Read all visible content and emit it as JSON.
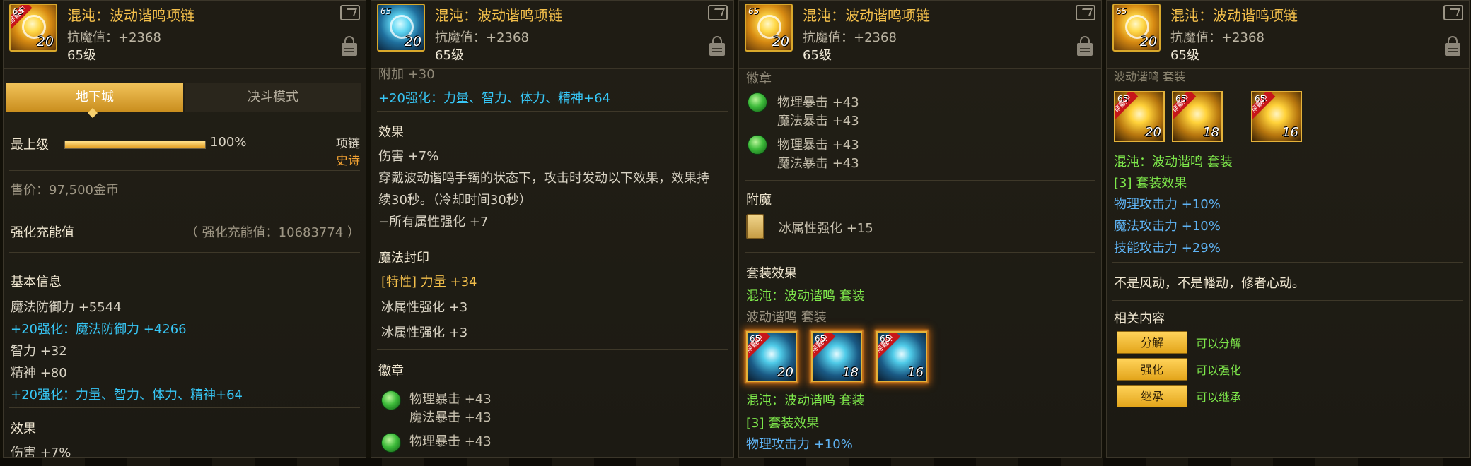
{
  "header": {
    "title": "混沌：波动谐鸣项链",
    "stat": "抗魔值：+2368",
    "level": "65级",
    "icon_level": "65",
    "icon_number": "20",
    "worn_ribbon": "穿戴中"
  },
  "panel1": {
    "tabs": [
      "地下城",
      "决斗模式"
    ],
    "grade_label": "最上级",
    "grade_percent": "100%",
    "grade_fill": 1.0,
    "item_type": "项链",
    "rarity": "史诗",
    "price": "售价：97,500金币",
    "charge_label": "强化充能值",
    "charge_value": "（ 强化充能值：10683774 ）",
    "basic_title": "基本信息",
    "basic_lines": [
      "魔法防御力 +5544",
      "+20强化：魔法防御力 +4266",
      "智力 +32",
      "精神 +80",
      "+20强化：力量、智力、体力、精神+64"
    ],
    "effect_title": "效果",
    "effect_cut": "伤害 +7%"
  },
  "panel2": {
    "cut_top": "附加 +30",
    "enhance_line": "+20强化：力量、智力、体力、精神+64",
    "effect_title": "效果",
    "effect_lines": [
      "伤害 +7%",
      "穿戴波动谐鸣手镯的状态下，攻击时发动以下效果，效果持",
      "续30秒。（冷却时间30秒）",
      "−所有属性强化 +7"
    ],
    "seal_title": "魔法封印",
    "seal_special_tag": "[特性]",
    "seal_special_stat": " 力量 +34",
    "seal_lines": [
      "冰属性强化 +3",
      "冰属性强化 +3"
    ],
    "emblem_title": "徽章",
    "emblem1": [
      "物理暴击 +43",
      "魔法暴击 +43"
    ],
    "emblem2": [
      "物理暴击 +43"
    ]
  },
  "panel3": {
    "cut_top": "徽章",
    "emblem1": [
      "物理暴击 +43",
      "魔法暴击 +43"
    ],
    "emblem2": [
      "物理暴击 +43",
      "魔法暴击 +43"
    ],
    "enchant_title": "附魔",
    "enchant_value": "冰属性强化 +15",
    "set_title": "套装效果",
    "set_name": "混沌：波动谐鸣  套装",
    "set_name_gray": "波动谐鸣  套装",
    "set_icons": [
      {
        "num": "20"
      },
      {
        "num": "18"
      },
      {
        "num": "16"
      }
    ],
    "set_name2": "混沌：波动谐鸣  套装",
    "set_bonus_title": "[3] 套装效果",
    "set_bonus_line": "物理攻击力 +10%"
  },
  "panel4": {
    "cut_top": "波动谐鸣  套装",
    "set_icons": [
      {
        "num": "20"
      },
      {
        "num": "18"
      },
      {
        "num": "16"
      }
    ],
    "set_name": "混沌：波动谐鸣  套装",
    "set_bonus_title": "[3] 套装效果",
    "set_bonus_lines": [
      "物理攻击力 +10%",
      "魔法攻击力 +10%",
      "技能攻击力 +29%"
    ],
    "flavor": "不是风动，不是幡动，修者心动。",
    "related_title": "相关内容",
    "actions": [
      {
        "button": "分解",
        "note": "可以分解"
      },
      {
        "button": "强化",
        "note": "可以强化"
      },
      {
        "button": "继承",
        "note": "可以继承"
      }
    ]
  }
}
